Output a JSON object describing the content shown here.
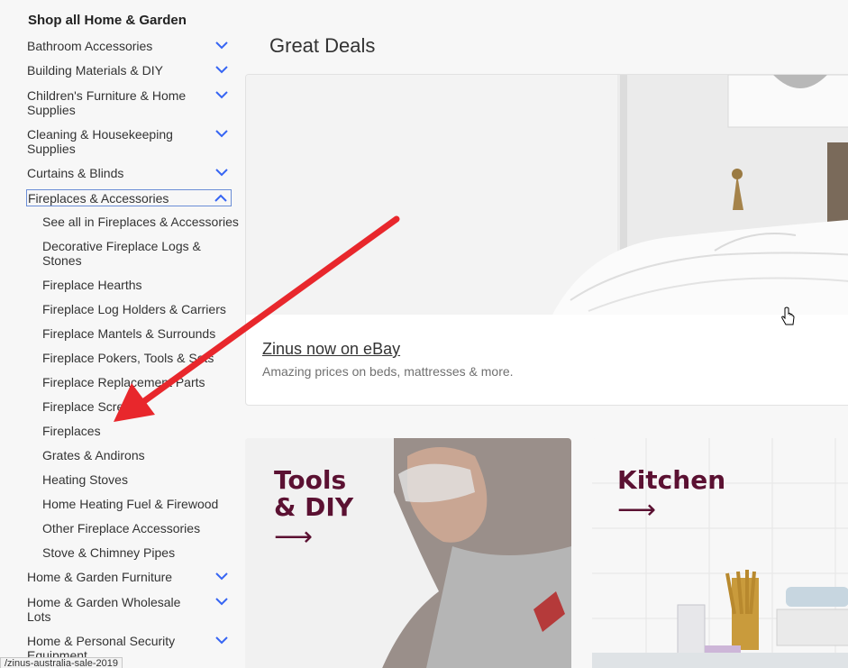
{
  "sidebar": {
    "title": "Shop all Home & Garden",
    "categories_top": [
      {
        "label": "Bathroom Accessories"
      },
      {
        "label": "Building Materials & DIY"
      },
      {
        "label": "Children's Furniture & Home Supplies"
      },
      {
        "label": "Cleaning & Housekeeping Supplies"
      },
      {
        "label": "Curtains & Blinds"
      }
    ],
    "open_category": {
      "label": "Fireplaces & Accessories"
    },
    "subcategories": [
      {
        "label": "See all in Fireplaces & Accessories"
      },
      {
        "label": "Decorative Fireplace Logs & Stones"
      },
      {
        "label": "Fireplace Hearths"
      },
      {
        "label": "Fireplace Log Holders & Carriers"
      },
      {
        "label": "Fireplace Mantels & Surrounds"
      },
      {
        "label": "Fireplace Pokers, Tools & Sets"
      },
      {
        "label": "Fireplace Replacement Parts"
      },
      {
        "label": "Fireplace Screens"
      },
      {
        "label": "Fireplaces"
      },
      {
        "label": "Grates & Andirons"
      },
      {
        "label": "Heating Stoves"
      },
      {
        "label": "Home Heating Fuel & Firewood"
      },
      {
        "label": "Other Fireplace Accessories"
      },
      {
        "label": "Stove & Chimney Pipes"
      }
    ],
    "categories_bottom": [
      {
        "label": "Home & Garden Furniture"
      },
      {
        "label": "Home & Garden Wholesale Lots"
      },
      {
        "label": "Home & Personal Security Equipment"
      }
    ]
  },
  "main": {
    "heading": "Great Deals",
    "deal": {
      "title": "Zinus now on eBay",
      "subtitle": "Amazing prices on beds, mattresses & more."
    },
    "promos": [
      {
        "title_line1": "Tools",
        "title_line2": "& DIY",
        "arrow": "⟶"
      },
      {
        "title_line1": "Kitchen",
        "arrow": "⟶"
      }
    ]
  },
  "status_bar": {
    "url": "/zinus-australia-sale-2019"
  },
  "colors": {
    "accent_chevron": "#3665f3",
    "promo_text": "#5b1132",
    "annotation_arrow": "#e8272c"
  }
}
